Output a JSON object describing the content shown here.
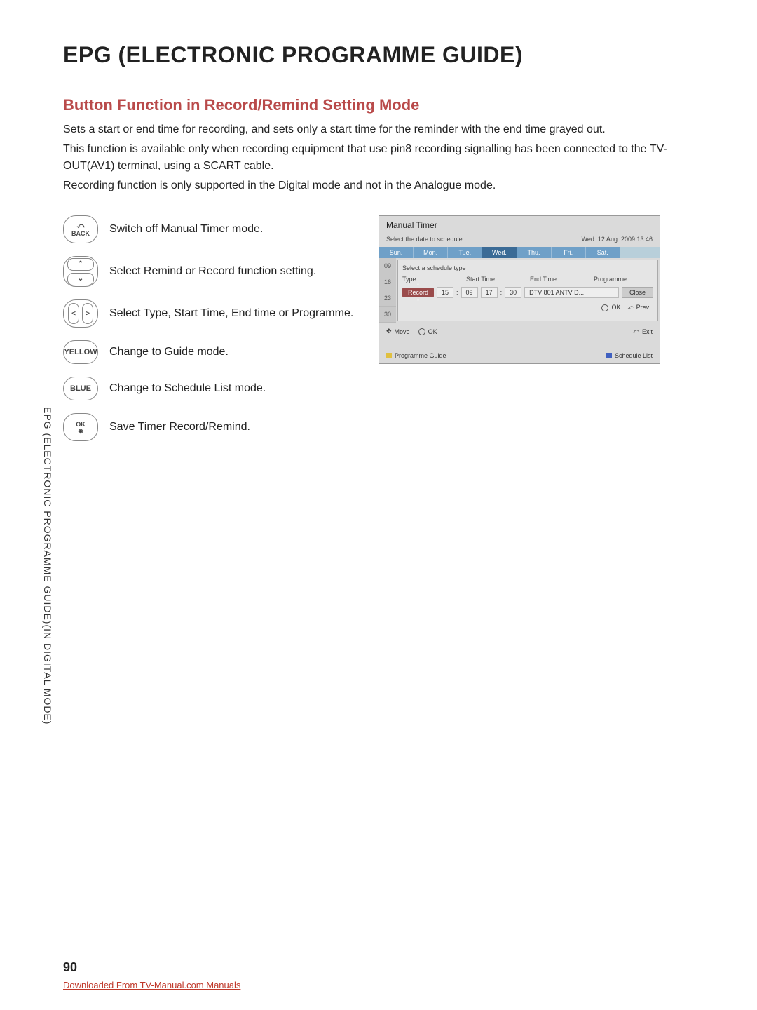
{
  "title": "EPG (ELECTRONIC PROGRAMME GUIDE)",
  "section_title": "Button Function in Record/Remind Setting Mode",
  "para1": "Sets a start or end time for recording, and sets only a start time for the reminder with the end time grayed out.",
  "para2": "This function is available only when recording equipment that use pin8 recording signalling has been connected to the TV-OUT(AV1) terminal, using a SCART cable.",
  "para3": "Recording function is only supported in the Digital mode and not in the Analogue mode.",
  "buttons": {
    "back": {
      "label": "BACK",
      "desc": "Switch off Manual Timer mode."
    },
    "updown": {
      "desc": "Select Remind or Record function setting."
    },
    "leftright": {
      "desc": "Select Type, Start Time, End time or Programme."
    },
    "yellow": {
      "label": "YELLOW",
      "desc": "Change to Guide mode."
    },
    "blue": {
      "label": "BLUE",
      "desc": "Change to Schedule List mode."
    },
    "ok": {
      "label": "OK",
      "desc": "Save Timer Record/Remind."
    }
  },
  "timer": {
    "title": "Manual Timer",
    "subtitle": "Select the date to schedule.",
    "datetime": "Wed. 12 Aug. 2009 13:46",
    "days": [
      "Sun.",
      "Mon.",
      "Tue.",
      "Wed.",
      "Thu.",
      "Fri.",
      "Sat."
    ],
    "dates": [
      "09",
      "16",
      "23",
      "30"
    ],
    "hint": "Select a schedule type",
    "cols": {
      "type": "Type",
      "start": "Start Time",
      "end": "End Time",
      "prog": "Programme"
    },
    "row": {
      "type": "Record",
      "sh": "15",
      "sm": "09",
      "eh": "17",
      "em": "30",
      "prog": "DTV 801 ANTV D...",
      "close": "Close"
    },
    "f1_ok": "OK",
    "f1_prev": "Prev.",
    "footer": {
      "move": "Move",
      "ok": "OK",
      "exit": "Exit",
      "pg": "Programme Guide",
      "sl": "Schedule List"
    }
  },
  "side": "EPG (ELECTRONIC PROGRAMME GUIDE)(IN DIGITAL MODE)",
  "page_num": "90",
  "download": "Downloaded From TV-Manual.com Manuals"
}
